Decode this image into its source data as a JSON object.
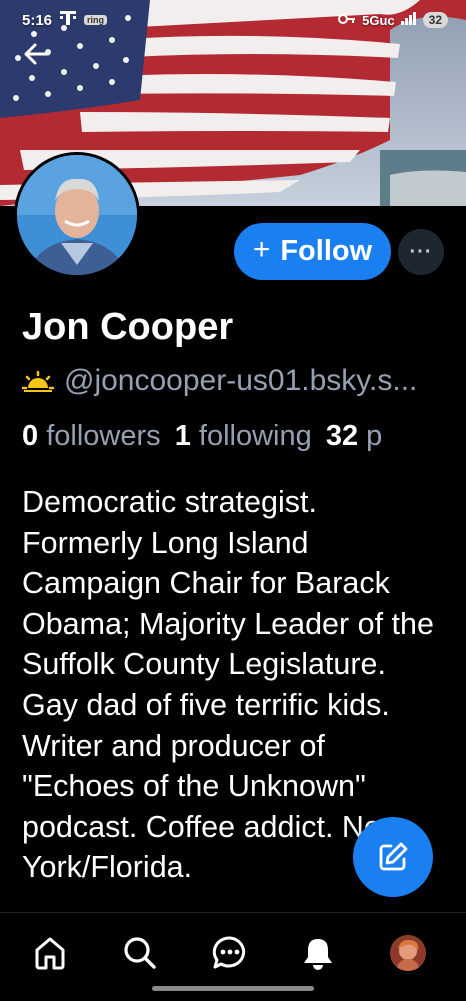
{
  "status_bar": {
    "time": "5:16",
    "carrier_icon": "carrier-icon",
    "app_badge": "ring",
    "network": "5Guc",
    "battery": "32"
  },
  "header": {
    "back_icon": "arrow-left-icon"
  },
  "profile": {
    "name": "Jon Cooper",
    "handle_icon": "sun-icon",
    "handle": "@joncooper-us01.bsky.s...",
    "followers_count": "0",
    "followers_label": "followers",
    "following_count": "1",
    "following_label": "following",
    "posts_count": "32",
    "posts_label": "p",
    "bio": "Democratic strategist. Formerly Long Island Campaign Chair for Barack Obama; Majority Leader of the Suffolk County Legislature. Gay dad of five terrific kids. Writer and producer of \"Echoes of the Unknown\" podcast. Coffee addict. New York/Florida."
  },
  "actions": {
    "follow_plus": "+",
    "follow_label": "Follow",
    "more_label": "···"
  },
  "fab": {
    "icon": "compose-icon"
  },
  "bottom_nav": [
    {
      "icon": "home-icon"
    },
    {
      "icon": "search-icon"
    },
    {
      "icon": "chat-icon"
    },
    {
      "icon": "bell-icon"
    },
    {
      "icon": "profile-avatar"
    }
  ],
  "colors": {
    "accent": "#1a7ff0",
    "muted_text": "#95a1b2",
    "background": "#000000"
  }
}
